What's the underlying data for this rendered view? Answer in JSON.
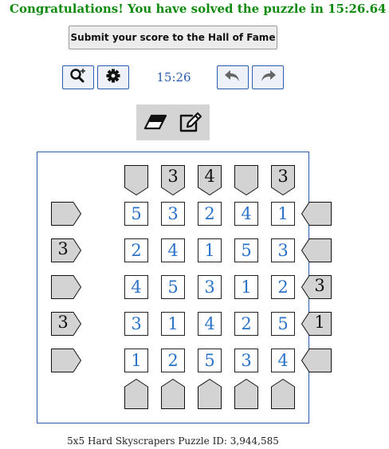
{
  "status": {
    "message": "Congratulations! You have solved the puzzle in 15:26.64"
  },
  "toolbar": {
    "submit_label": "Submit your score to the Hall of Fame",
    "timer": "15:26"
  },
  "puzzle": {
    "size": 5,
    "grid": [
      [
        5,
        3,
        2,
        4,
        1
      ],
      [
        2,
        4,
        1,
        5,
        3
      ],
      [
        4,
        5,
        3,
        1,
        2
      ],
      [
        3,
        1,
        4,
        2,
        5
      ],
      [
        1,
        2,
        5,
        3,
        4
      ]
    ],
    "clues": {
      "top": [
        "",
        "3",
        "4",
        "",
        "3"
      ],
      "bottom": [
        "",
        "",
        "",
        "",
        ""
      ],
      "left": [
        "",
        "3",
        "",
        "3",
        ""
      ],
      "right": [
        "",
        "",
        "3",
        "1",
        ""
      ]
    }
  },
  "footer": {
    "info": "5x5 Hard Skyscrapers Puzzle ID: 3,944,585"
  },
  "colors": {
    "congrats": "#0f8a0f",
    "accent": "#2a5db0",
    "cell_digit": "#2a73c8",
    "clue_fill": "#d3d3d3"
  },
  "icons": [
    "zoom-in-icon",
    "gear-icon",
    "undo-icon",
    "redo-icon",
    "eraser-icon",
    "pencil-edit-icon"
  ]
}
